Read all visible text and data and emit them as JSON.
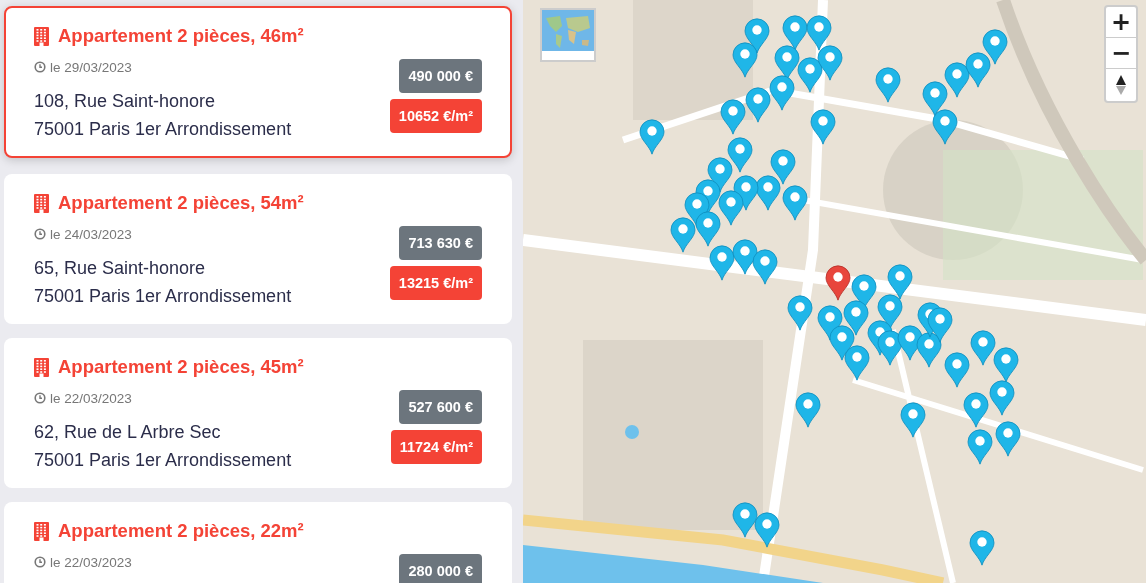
{
  "listings": [
    {
      "title": "Appartement 2 pièces, 46m²",
      "date": "le 29/03/2023",
      "address_line_1": "108, Rue Saint-honore",
      "address_line_2": "75001 Paris 1er Arrondissement",
      "price": "490 000 €",
      "price_per_m2": "10652 €/m²",
      "selected": true
    },
    {
      "title": "Appartement 2 pièces, 54m²",
      "date": "le 24/03/2023",
      "address_line_1": "65, Rue Saint-honore",
      "address_line_2": "75001 Paris 1er Arrondissement",
      "price": "713 630 €",
      "price_per_m2": "13215 €/m²",
      "selected": false
    },
    {
      "title": "Appartement 2 pièces, 45m²",
      "date": "le 22/03/2023",
      "address_line_1": "62, Rue de L Arbre Sec",
      "address_line_2": "75001 Paris 1er Arrondissement",
      "price": "527 600 €",
      "price_per_m2": "11724 €/m²",
      "selected": false
    },
    {
      "title": "Appartement 2 pièces, 22m²",
      "date": "le 22/03/2023",
      "price": "280 000 €",
      "selected": false
    }
  ],
  "map": {
    "zoom_in": "+",
    "zoom_out": "−",
    "markers": [
      {
        "selected": false
      },
      {
        "selected": false
      },
      {
        "selected": false
      },
      {
        "selected": false
      },
      {
        "selected": false
      },
      {
        "selected": false
      },
      {
        "selected": false
      },
      {
        "selected": false
      },
      {
        "selected": false
      },
      {
        "selected": false
      },
      {
        "selected": false
      },
      {
        "selected": false
      },
      {
        "selected": false
      },
      {
        "selected": false
      },
      {
        "selected": false
      },
      {
        "selected": false
      },
      {
        "selected": false
      },
      {
        "selected": false
      },
      {
        "selected": false
      },
      {
        "selected": false
      },
      {
        "selected": false
      },
      {
        "selected": false
      },
      {
        "selected": false
      },
      {
        "selected": false
      },
      {
        "selected": false
      },
      {
        "selected": false
      },
      {
        "selected": false
      },
      {
        "selected": false
      },
      {
        "selected": false
      },
      {
        "selected": false
      },
      {
        "selected": false
      },
      {
        "selected": false
      },
      {
        "selected": true
      },
      {
        "selected": false
      },
      {
        "selected": false
      },
      {
        "selected": false
      },
      {
        "selected": false
      },
      {
        "selected": false
      },
      {
        "selected": false
      },
      {
        "selected": false
      },
      {
        "selected": false
      },
      {
        "selected": false
      },
      {
        "selected": false
      },
      {
        "selected": false
      },
      {
        "selected": false
      },
      {
        "selected": false
      },
      {
        "selected": false
      },
      {
        "selected": false
      },
      {
        "selected": false
      },
      {
        "selected": false
      },
      {
        "selected": false
      },
      {
        "selected": false
      },
      {
        "selected": false
      },
      {
        "selected": false
      },
      {
        "selected": false
      },
      {
        "selected": false
      },
      {
        "selected": false
      },
      {
        "selected": false
      },
      {
        "selected": false
      }
    ]
  }
}
